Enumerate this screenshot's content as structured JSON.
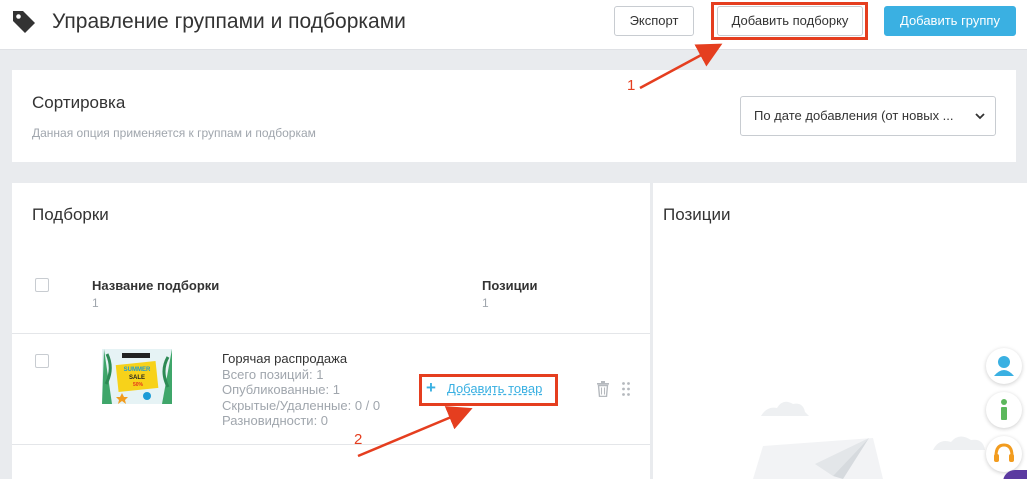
{
  "header": {
    "title": "Управление группами и подборками",
    "export_label": "Экспорт",
    "add_collection_label": "Добавить подборку",
    "add_group_label": "Добавить группу"
  },
  "sort": {
    "title": "Сортировка",
    "description": "Данная опция применяется к группам и подборкам",
    "selected": "По дате добавления (от новых ..."
  },
  "collections": {
    "title": "Подборки",
    "columns": [
      {
        "label": "Название подборки",
        "sub": "1"
      },
      {
        "label": "Позиции",
        "sub": "1"
      }
    ],
    "rows": [
      {
        "name": "Горячая распродажа",
        "thumbnail_text": "SUMMER SALE 50%",
        "stats": [
          "Всего позиций: 1",
          "Опубликованные: 1",
          "Скрытые/Удаленные: 0 / 0",
          "Разновидности: 0"
        ],
        "add_item_label": "Добавить товар"
      }
    ]
  },
  "positions": {
    "title": "Позиции"
  },
  "annotations": {
    "step_1": "1",
    "step_2": "2",
    "color": "#e53e1f"
  },
  "colors": {
    "accent": "#3ab0e2",
    "background": "#e9ebee"
  },
  "floating_buttons": [
    "user-icon",
    "info-icon",
    "headset-icon"
  ]
}
